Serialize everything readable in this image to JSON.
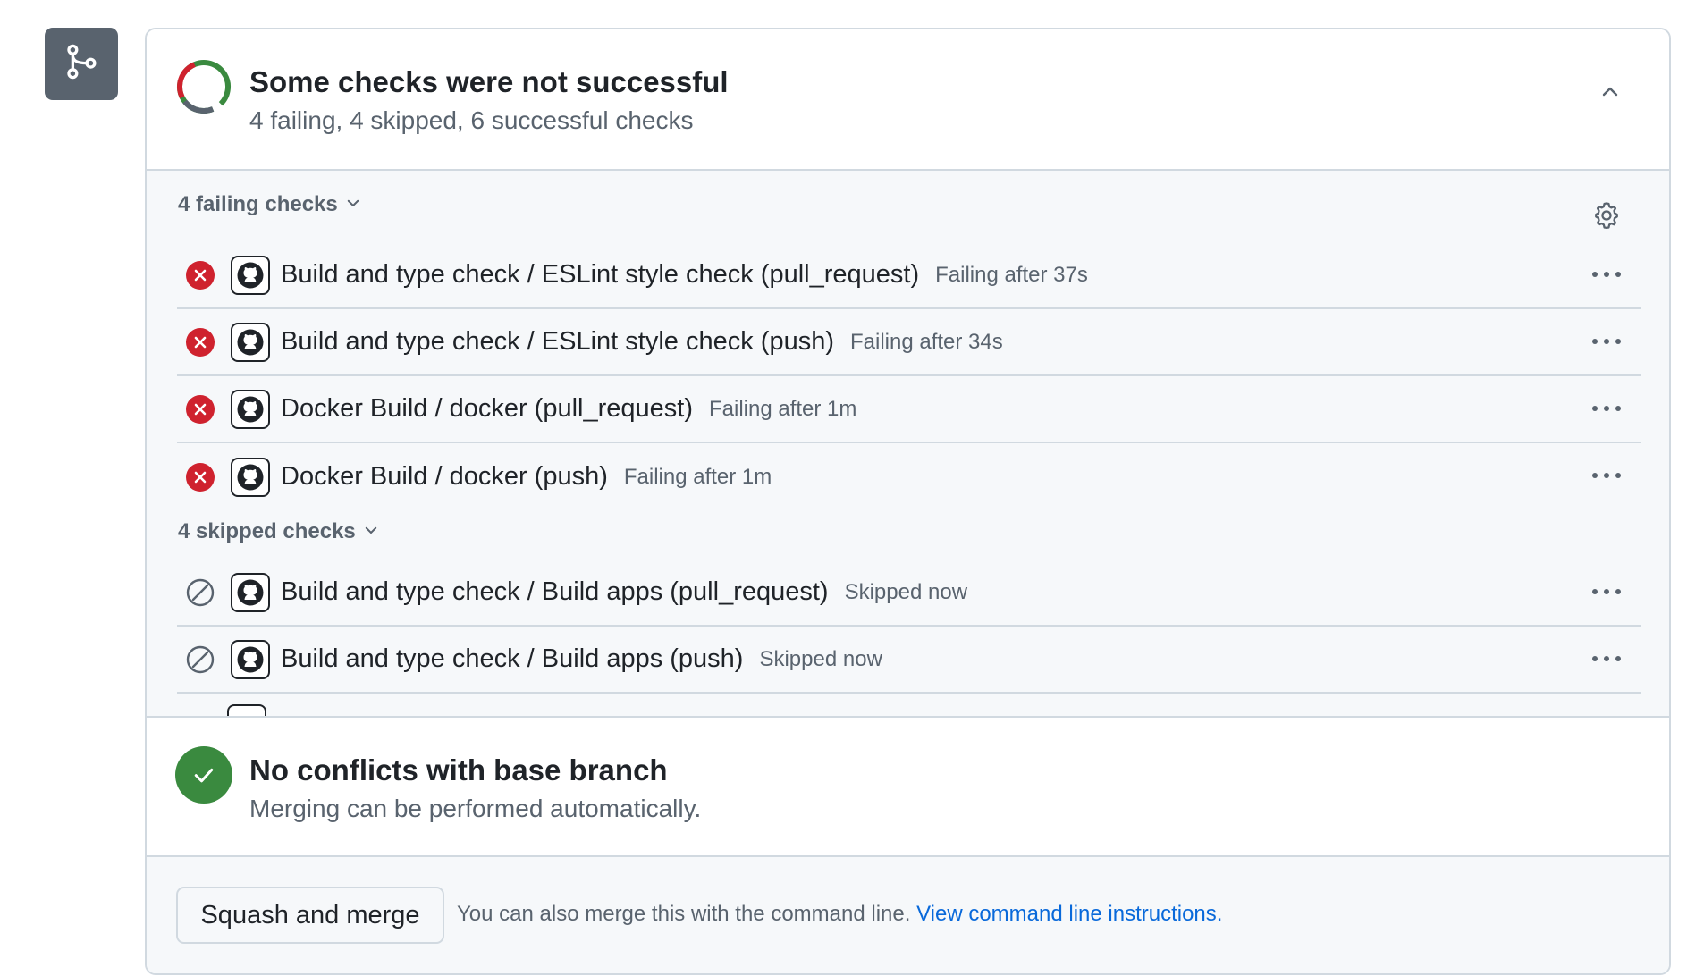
{
  "icons": {
    "merge_badge": "git-branch-icon",
    "status_ring": "partial-status-ring-icon",
    "collapse": "chevron-up-icon",
    "settings": "gear-icon",
    "app_avatar": "github-icon",
    "failing": "x-circle-fill-icon",
    "skipped": "skip-icon",
    "more": "kebab-horizontal-icon",
    "ok": "check-circle-fill-icon"
  },
  "colors": {
    "fail": "#cf222e",
    "success": "#3a8a3f",
    "skipped": "#59636e",
    "link": "#0969da"
  },
  "checks_header": {
    "title": "Some checks were not successful",
    "summary": "4 failing, 4 skipped, 6 successful checks"
  },
  "groups": {
    "failing": {
      "heading": "4 failing checks",
      "items": [
        {
          "name": "Build and type check / ESLint style check (pull_request)",
          "status": "Failing after 37s"
        },
        {
          "name": "Build and type check / ESLint style check (push)",
          "status": "Failing after 34s"
        },
        {
          "name": "Docker Build / docker (pull_request)",
          "status": "Failing after 1m"
        },
        {
          "name": "Docker Build / docker (push)",
          "status": "Failing after 1m"
        }
      ]
    },
    "skipped": {
      "heading": "4 skipped checks",
      "items": [
        {
          "name": "Build and type check / Build apps (pull_request)",
          "status": "Skipped now"
        },
        {
          "name": "Build and type check / Build apps (push)",
          "status": "Skipped now"
        }
      ]
    }
  },
  "conflicts": {
    "title": "No conflicts with base branch",
    "subtitle": "Merging can be performed automatically."
  },
  "merge": {
    "button_label": "Squash and merge",
    "hint": "You can also merge this with the command line.",
    "link_text": "View command line instructions."
  }
}
